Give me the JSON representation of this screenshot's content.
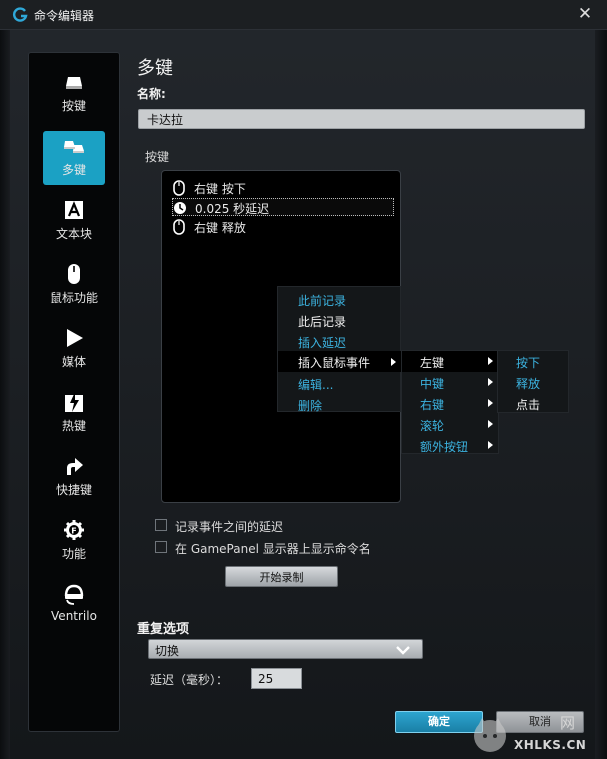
{
  "window": {
    "title": "命令编辑器"
  },
  "sidebar": {
    "items": [
      {
        "label": "按键",
        "icon": "key-icon"
      },
      {
        "label": "多键",
        "icon": "multikey-icon",
        "active": true
      },
      {
        "label": "文本块",
        "icon": "text-block-icon"
      },
      {
        "label": "鼠标功能",
        "icon": "mouse-icon"
      },
      {
        "label": "媒体",
        "icon": "play-icon"
      },
      {
        "label": "热键",
        "icon": "hotkey-icon"
      },
      {
        "label": "快捷键",
        "icon": "shortcut-arrow-icon"
      },
      {
        "label": "功能",
        "icon": "function-gear-icon"
      },
      {
        "label": "Ventrilo",
        "icon": "headset-icon"
      }
    ]
  },
  "main": {
    "heading": "多键",
    "name_label": "名称:",
    "name_value": "卡达拉",
    "keys_label": "按键",
    "events": [
      {
        "icon": "mouse-icon",
        "text": "右键 按下"
      },
      {
        "icon": "clock-icon",
        "text": "0.025 秒延迟",
        "selected": true
      },
      {
        "icon": "mouse-icon",
        "text": "右键 释放"
      }
    ]
  },
  "context_menu": {
    "items": [
      {
        "label": "此前记录",
        "style": "blue"
      },
      {
        "label": "此后记录",
        "style": "white"
      },
      {
        "label": "插入延迟",
        "style": "blue"
      },
      {
        "label": "插入鼠标事件",
        "style": "white",
        "submenu": true,
        "highlighted": true
      },
      {
        "label": "编辑...",
        "style": "blue"
      },
      {
        "label": "删除",
        "style": "blue"
      }
    ],
    "mouse_submenu": [
      {
        "label": "左键",
        "style": "white",
        "highlighted": true
      },
      {
        "label": "中键",
        "style": "blue"
      },
      {
        "label": "右键",
        "style": "blue"
      },
      {
        "label": "滚轮",
        "style": "blue"
      },
      {
        "label": "额外按钮",
        "style": "blue"
      }
    ],
    "action_submenu": [
      {
        "label": "按下",
        "style": "blue"
      },
      {
        "label": "释放",
        "style": "blue"
      },
      {
        "label": "点击",
        "style": "white"
      }
    ]
  },
  "options": {
    "record_delay_label": "记录事件之间的延迟",
    "record_delay_checked": false,
    "show_name_label": "在 GamePanel 显示器上显示命令名",
    "show_name_checked": false,
    "record_button": "开始录制"
  },
  "repeat": {
    "label": "重复选项",
    "selected": "切换",
    "delay_label": "延迟（毫秒）：",
    "delay_value": "25"
  },
  "footer": {
    "ok_label": "确定",
    "cancel_label": "取消"
  },
  "watermark": {
    "text": "XHLKS.CN",
    "cn": "网"
  },
  "colors": {
    "accent": "#1ba1c4",
    "menu_blue": "#3cb3e0"
  }
}
